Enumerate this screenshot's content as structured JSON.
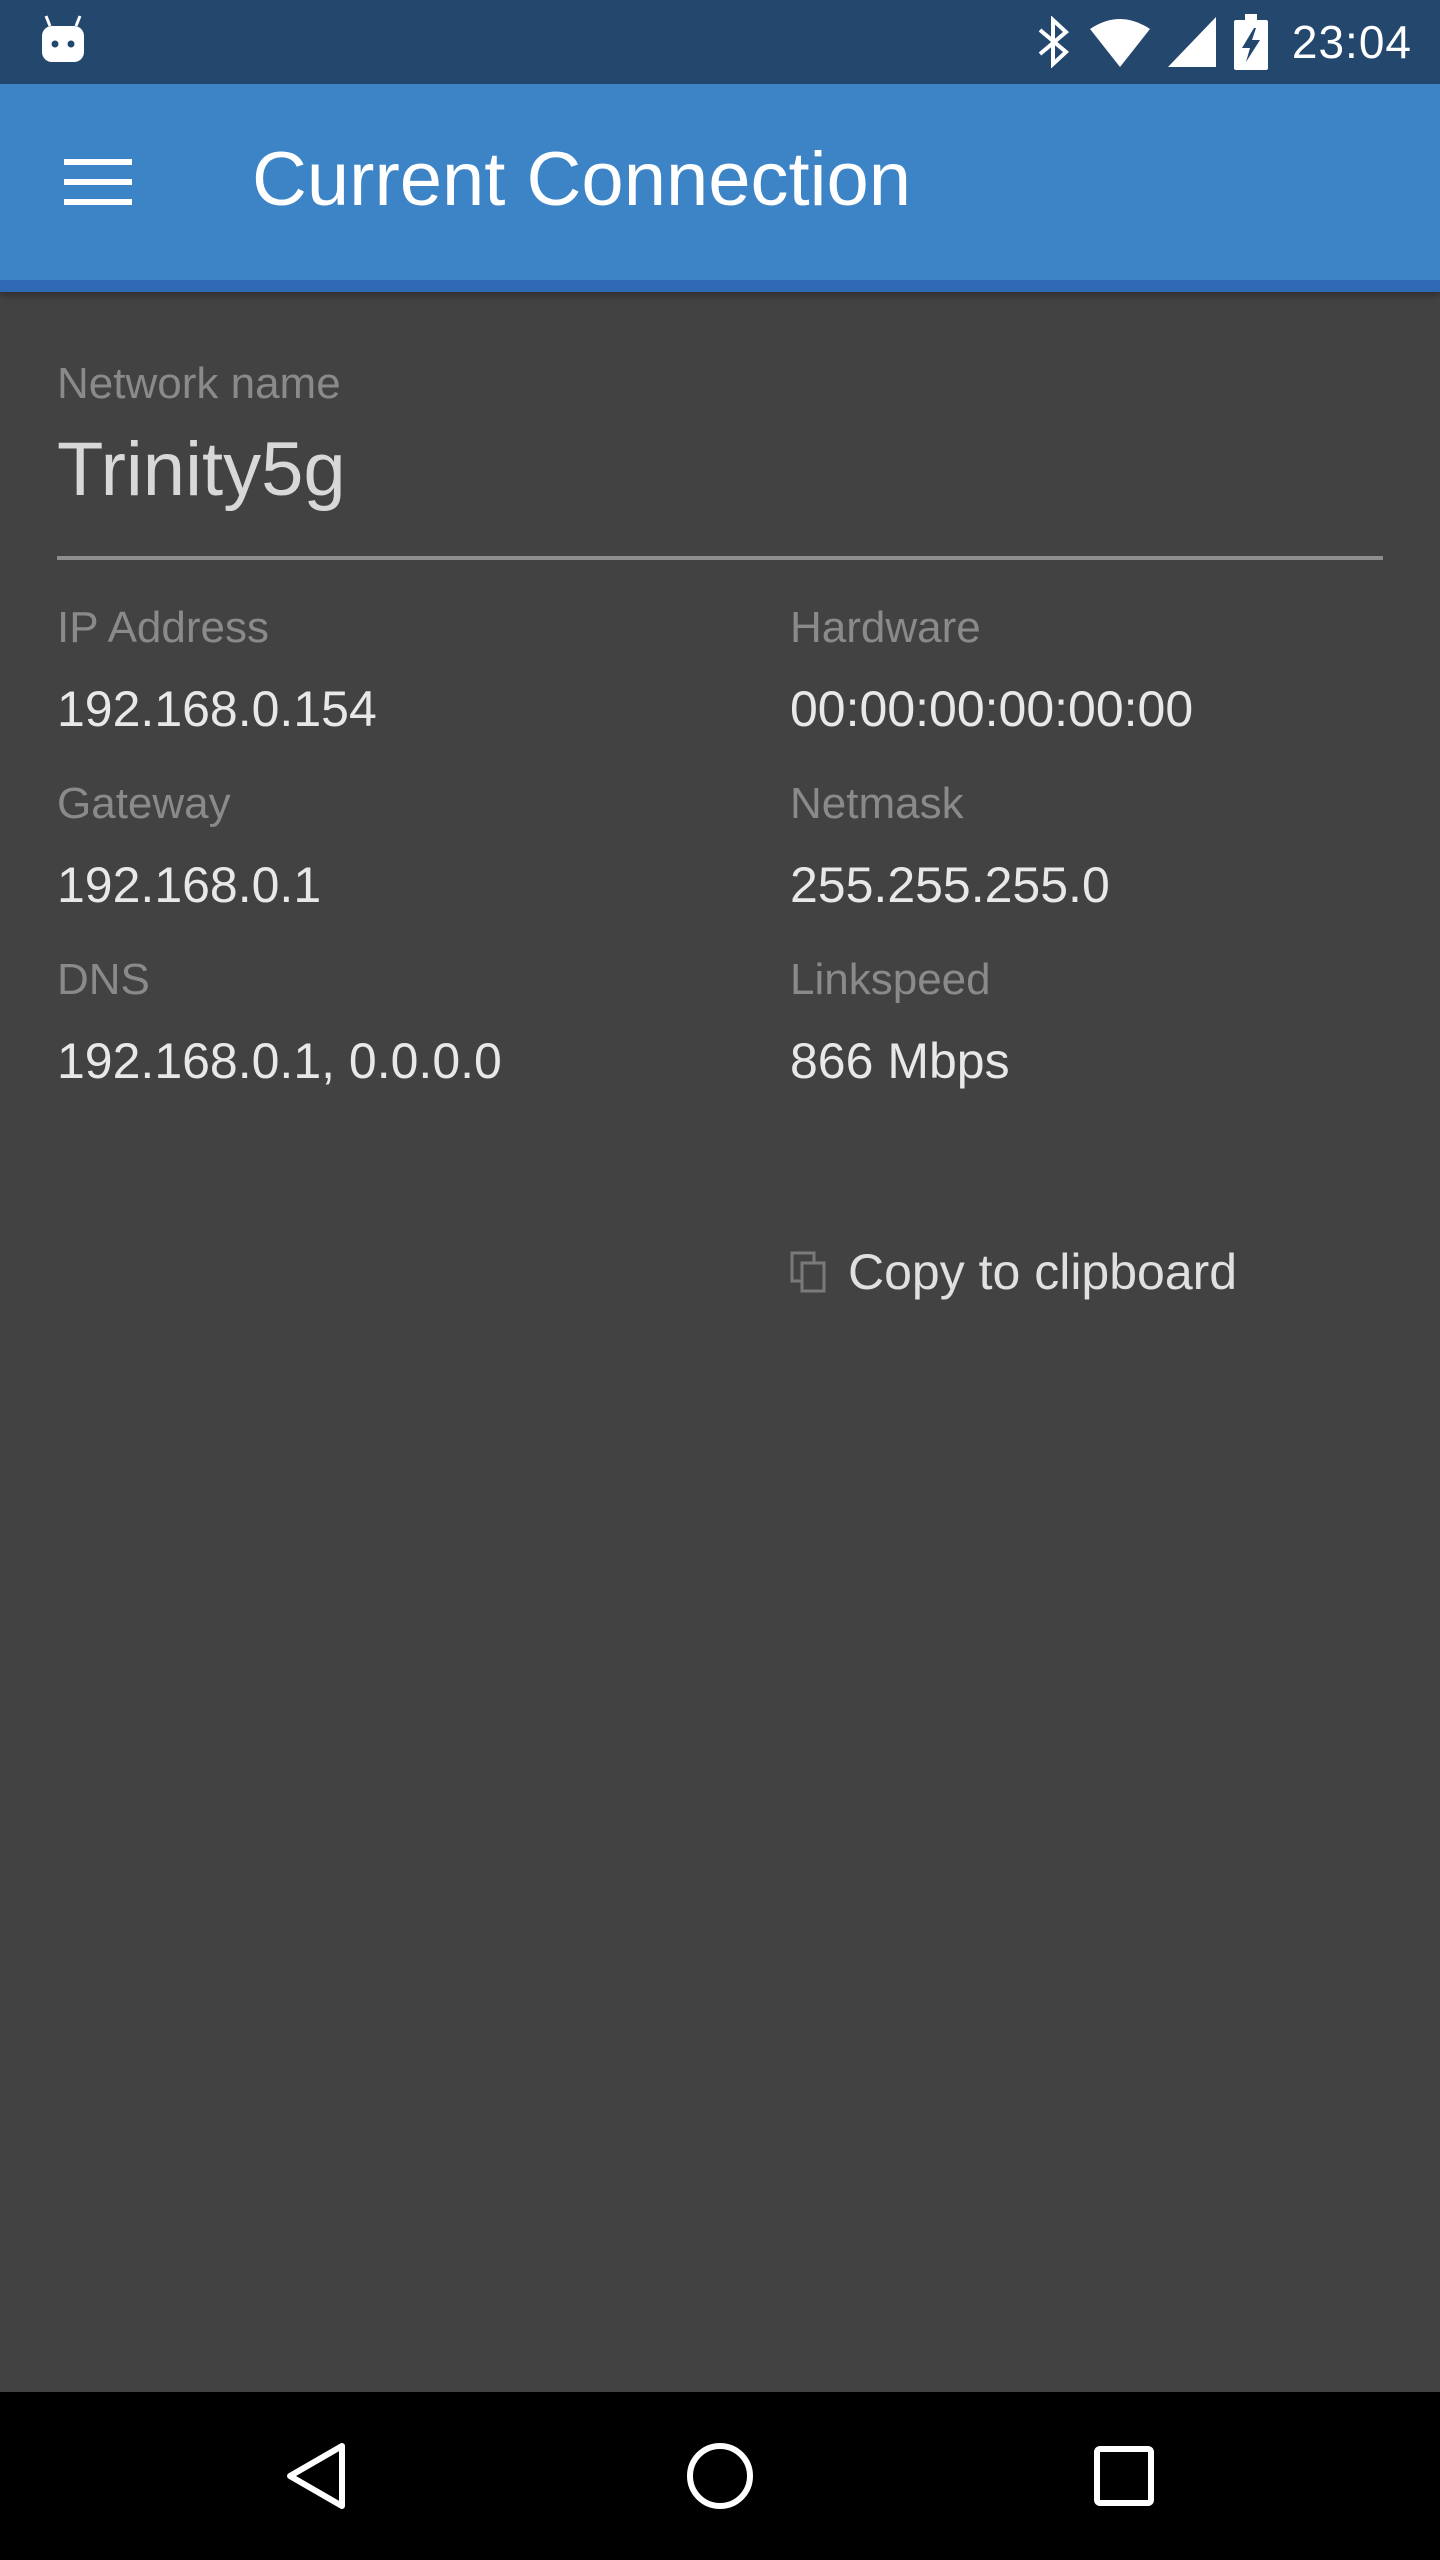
{
  "status_bar": {
    "time": "23:04",
    "icons": [
      "android-icon",
      "bluetooth-icon",
      "wifi-icon",
      "cell-signal-icon",
      "battery-charging-icon"
    ]
  },
  "app_bar": {
    "menu_icon": "hamburger-menu-icon",
    "title": "Current Connection"
  },
  "network": {
    "label": "Network name",
    "value": "Trinity5g"
  },
  "details": {
    "ip_label": "IP Address",
    "ip_value": "192.168.0.154",
    "hardware_label": "Hardware",
    "hardware_value": "00:00:00:00:00:00",
    "gateway_label": "Gateway",
    "gateway_value": "192.168.0.1",
    "netmask_label": "Netmask",
    "netmask_value": "255.255.255.0",
    "dns_label": "DNS",
    "dns_value": "192.168.0.1, 0.0.0.0",
    "linkspeed_label": "Linkspeed",
    "linkspeed_value": "866 Mbps"
  },
  "actions": {
    "copy_label": "Copy to clipboard",
    "copy_icon": "copy-icon"
  },
  "nav_bar": {
    "icons": [
      "back-icon",
      "home-icon",
      "recents-icon"
    ]
  },
  "colors": {
    "status_bar": "#24476e",
    "app_bar": "#3d84c6",
    "background": "#424242",
    "label": "#8a8a8a",
    "value": "#e8e8e8"
  }
}
